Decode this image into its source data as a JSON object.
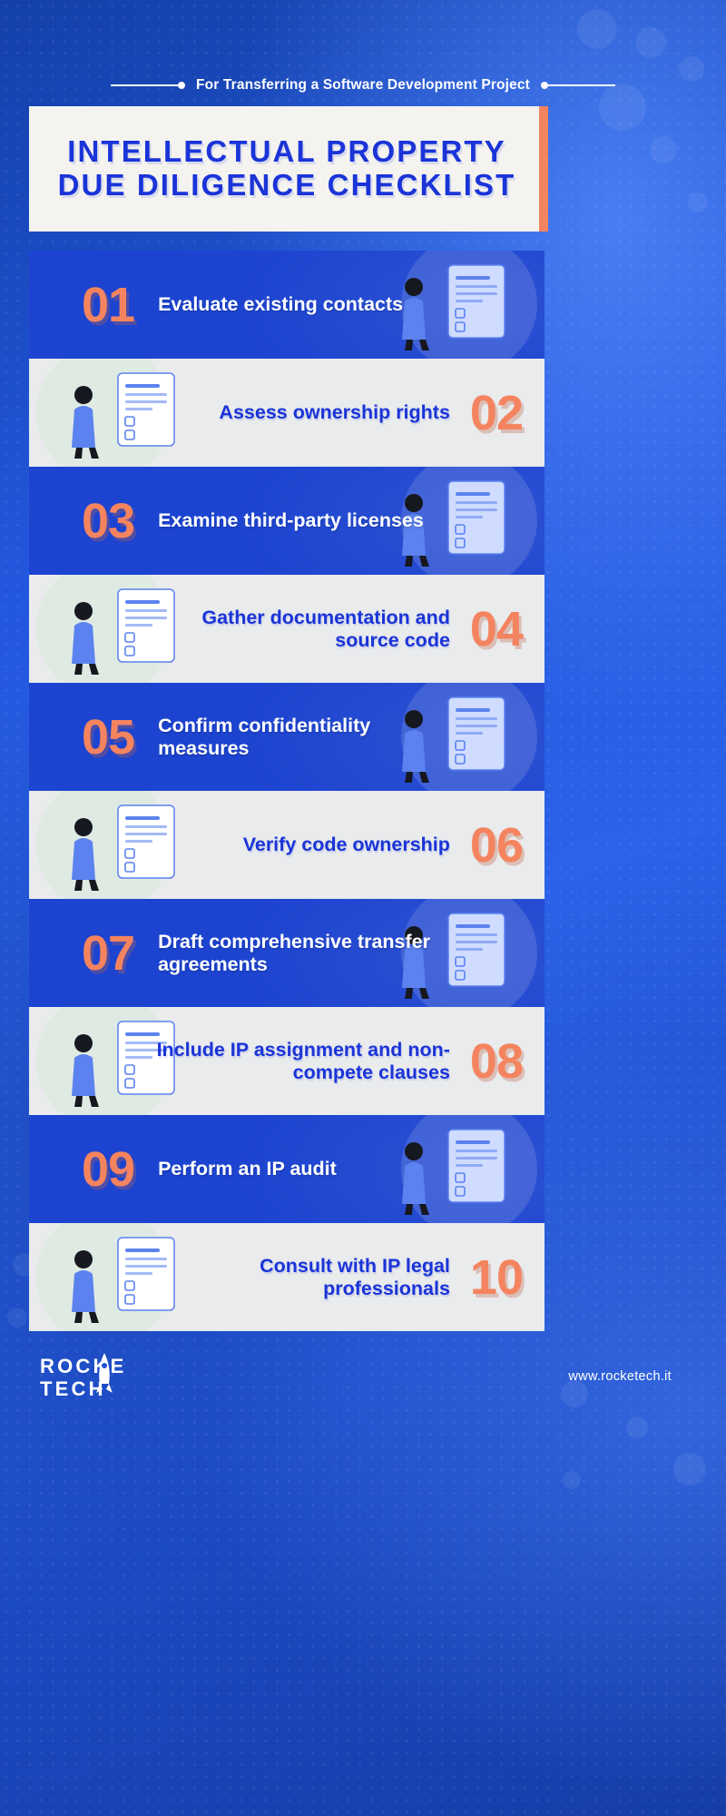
{
  "header": {
    "eyebrow": "For Transferring a Software Development Project",
    "title": "INTELLECTUAL PROPERTY DUE DILIGENCE CHECKLIST"
  },
  "colors": {
    "background_blue": "#1e50d2",
    "row_dark": "#1d44d0",
    "row_light": "#e9ebec",
    "accent_orange": "#f4845f",
    "title_card": "#f4f3ef",
    "text_blue": "#1a34d8",
    "text_white": "#ffffff"
  },
  "checklist": [
    {
      "number": "01",
      "label": "Evaluate existing contacts",
      "style": "dark",
      "illustration": "team-checklist-illustration"
    },
    {
      "number": "02",
      "label": "Assess ownership rights",
      "style": "light",
      "illustration": "shield-lock-folder-illustration"
    },
    {
      "number": "03",
      "label": "Examine third-party licenses",
      "style": "dark",
      "illustration": "approval-screens-illustration"
    },
    {
      "number": "04",
      "label": "Gather documentation and source code",
      "style": "light",
      "illustration": "documents-laptop-illustration"
    },
    {
      "number": "05",
      "label": "Confirm confidentiality measures",
      "style": "dark",
      "illustration": "nda-megaphone-illustration"
    },
    {
      "number": "06",
      "label": "Verify code ownership",
      "style": "light",
      "illustration": "mobile-collaboration-illustration"
    },
    {
      "number": "07",
      "label": "Draft comprehensive transfer agreements",
      "style": "dark",
      "illustration": "rocket-target-checklist-illustration"
    },
    {
      "number": "08",
      "label": "Include IP assignment and non-compete clauses",
      "style": "light",
      "illustration": "laptop-shield-cloud-illustration"
    },
    {
      "number": "09",
      "label": "Perform an IP audit",
      "style": "dark",
      "illustration": "magnifier-chart-illustration"
    },
    {
      "number": "10",
      "label": "Consult with IP legal professionals",
      "style": "light",
      "illustration": "consultation-question-illustration"
    }
  ],
  "footer": {
    "logo_line1": "ROCKE",
    "logo_line2": "TECH",
    "url": "www.rocketech.it"
  }
}
